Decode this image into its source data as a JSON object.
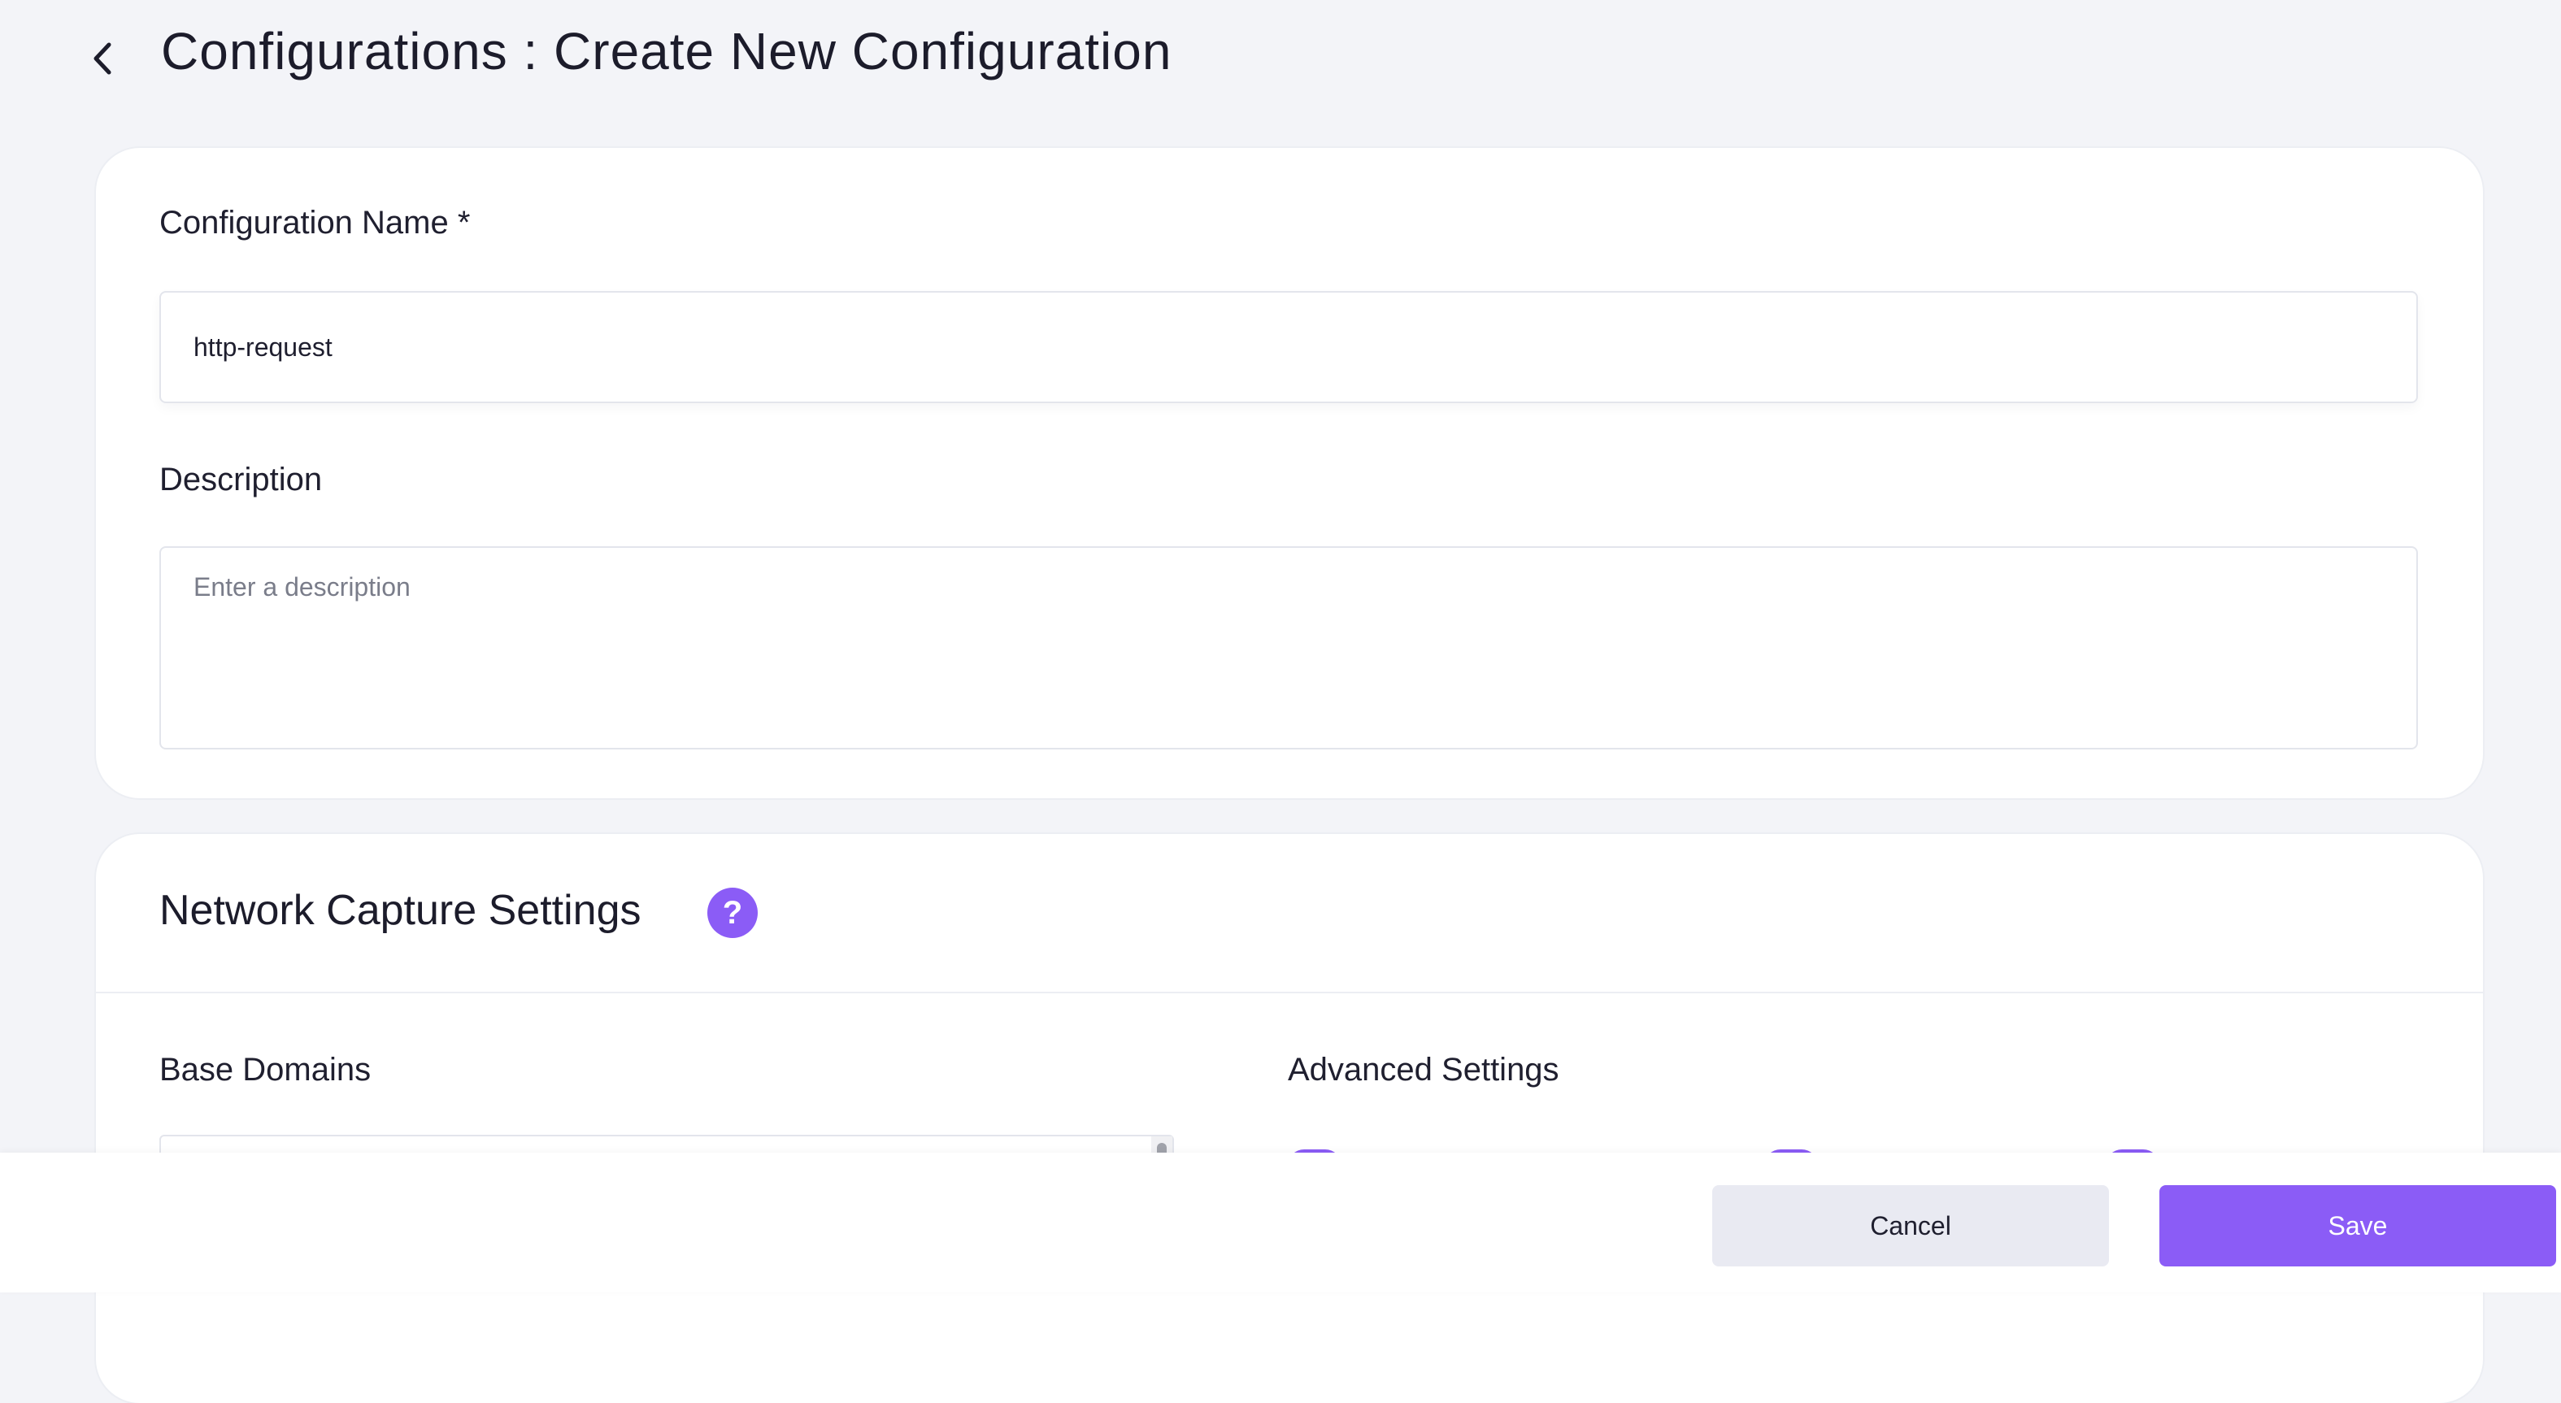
{
  "header": {
    "title": "Configurations : Create New Configuration"
  },
  "form": {
    "name_label": "Configuration Name *",
    "name_value": "http-request",
    "description_label": "Description",
    "description_placeholder": "Enter a description"
  },
  "network": {
    "title": "Network Capture Settings",
    "help_glyph": "?",
    "base_domains_label": "Base Domains",
    "advanced_settings_label": "Advanced Settings"
  },
  "footer": {
    "cancel_label": "Cancel",
    "save_label": "Save"
  },
  "colors": {
    "accent": "#8b5cf6",
    "background": "#f3f4f8",
    "cancel_bg": "#e9eaf2"
  },
  "icons": {
    "back": "chevron-left-icon",
    "help": "question-mark-icon"
  }
}
